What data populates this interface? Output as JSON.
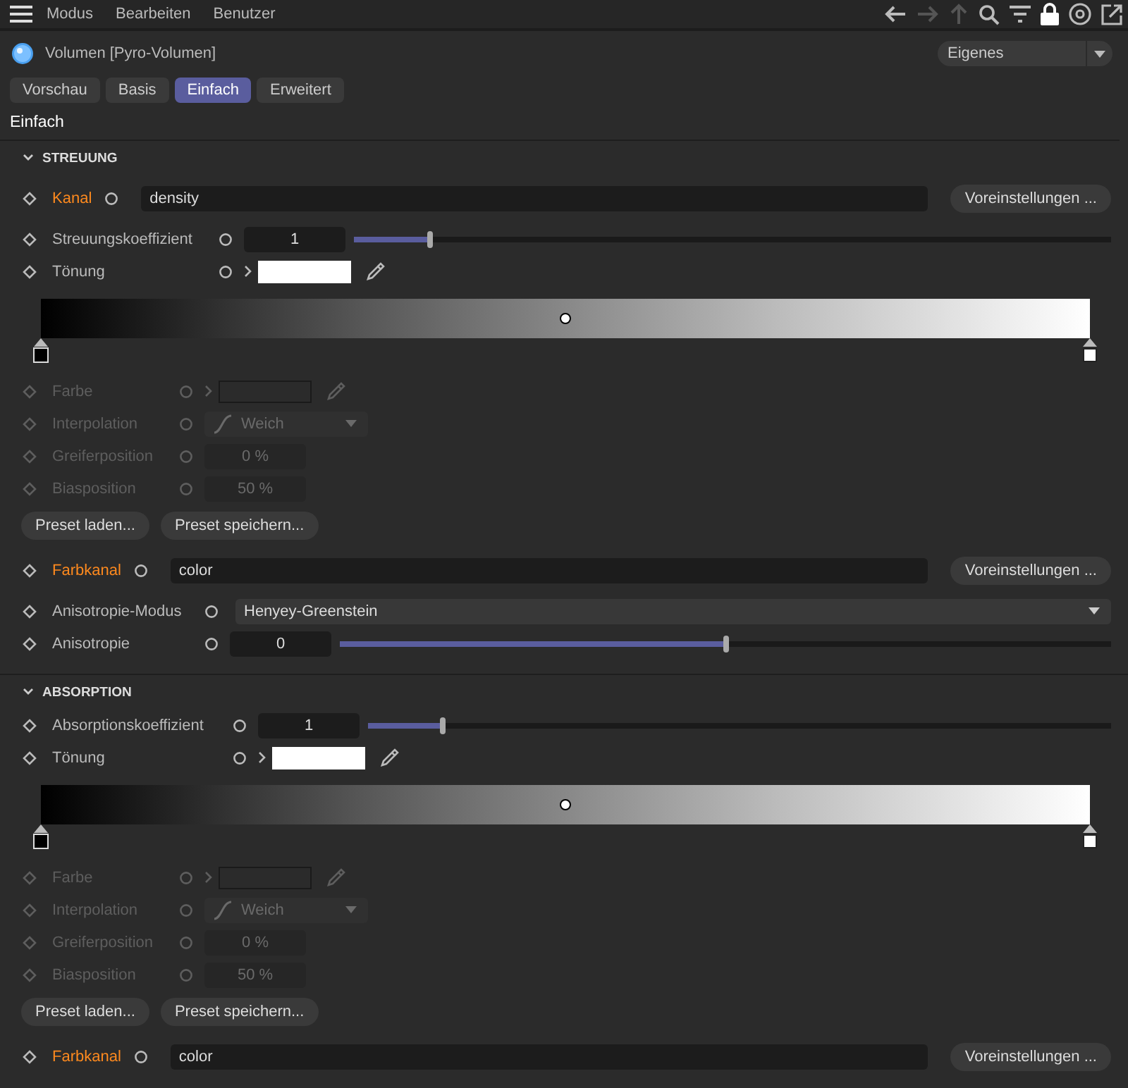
{
  "menu": [
    "Modus",
    "Bearbeiten",
    "Benutzer"
  ],
  "object": {
    "title": "Volumen [Pyro-Volumen]",
    "preset": "Eigenes"
  },
  "tabs": [
    {
      "label": "Vorschau",
      "selected": false
    },
    {
      "label": "Basis",
      "selected": false
    },
    {
      "label": "Einfach",
      "selected": true
    },
    {
      "label": "Erweitert",
      "selected": false
    }
  ],
  "page_title": "Einfach",
  "sections": [
    {
      "title": "STREUUNG",
      "expanded": true,
      "rows": [
        {
          "kind": "channel",
          "label": "Kanal",
          "value": "density",
          "button": "Voreinstellungen ..."
        },
        {
          "kind": "slider",
          "label": "Streuungskoeffizient",
          "value": "1",
          "level": 0.1,
          "disabled": false
        },
        {
          "kind": "color",
          "label": "Tönung",
          "disabled": false
        },
        {
          "kind": "gradient"
        },
        {
          "kind": "color",
          "label": "Farbe",
          "disabled": true
        },
        {
          "kind": "interpolation",
          "label": "Interpolation",
          "value": "Weich",
          "disabled": true
        },
        {
          "kind": "number",
          "label": "Greiferposition",
          "value": "0 %",
          "disabled": true
        },
        {
          "kind": "number",
          "label": "Biasposition",
          "value": "50 %",
          "disabled": true
        },
        {
          "kind": "buttons",
          "buttons": [
            "Preset laden...",
            "Preset speichern..."
          ]
        },
        {
          "kind": "channel",
          "label": "Farbkanal",
          "value": "color",
          "button": "Voreinstellungen ..."
        },
        {
          "kind": "select",
          "label": "Anisotropie-Modus",
          "value": "Henyey-Greenstein",
          "disabled": false
        },
        {
          "kind": "slider",
          "label": "Anisotropie",
          "value": "0",
          "level": 0.5,
          "disabled": false
        }
      ]
    },
    {
      "title": "ABSORPTION",
      "expanded": true,
      "rows": [
        {
          "kind": "slider",
          "label": "Absorptionskoeffizient",
          "value": "1",
          "level": 0.1,
          "disabled": false
        },
        {
          "kind": "color",
          "label": "Tönung",
          "disabled": false
        },
        {
          "kind": "gradient"
        },
        {
          "kind": "color",
          "label": "Farbe",
          "disabled": true
        },
        {
          "kind": "interpolation",
          "label": "Interpolation",
          "value": "Weich",
          "disabled": true
        },
        {
          "kind": "number",
          "label": "Greiferposition",
          "value": "0 %",
          "disabled": true
        },
        {
          "kind": "number",
          "label": "Biasposition",
          "value": "50 %",
          "disabled": true
        },
        {
          "kind": "buttons",
          "buttons": [
            "Preset laden...",
            "Preset speichern..."
          ]
        },
        {
          "kind": "channel",
          "label": "Farbkanal",
          "value": "color",
          "button": "Voreinstellungen ..."
        }
      ]
    }
  ]
}
